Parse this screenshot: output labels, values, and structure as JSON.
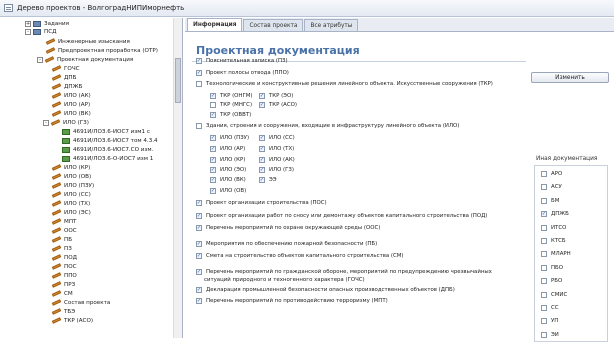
{
  "window": {
    "title": "Дерево проектов - ВолгоградНИПИморнефть"
  },
  "tree": {
    "items": [
      {
        "label": "Задания",
        "icon": "folder-icon",
        "expander": "+"
      },
      {
        "label": "ПСД",
        "icon": "folder-icon",
        "expander": "-"
      },
      {
        "label": "Инженерные изыскания",
        "icon": "pencil-icon"
      },
      {
        "label": "Предпроектная проработка (ОТР)",
        "icon": "pencil-icon"
      },
      {
        "label": "Проектная документация",
        "icon": "pencil-icon",
        "expander": "-"
      },
      {
        "label": "ГОЧС",
        "icon": "pencil-icon"
      },
      {
        "label": "ДПБ",
        "icon": "pencil-icon"
      },
      {
        "label": "ДПЖБ",
        "icon": "pencil-icon"
      },
      {
        "label": "ИЛО (АК)",
        "icon": "pencil-icon"
      },
      {
        "label": "ИЛО (АР)",
        "icon": "pencil-icon"
      },
      {
        "label": "ИЛО (ВК)",
        "icon": "pencil-icon"
      },
      {
        "label": "ИЛО (ГЗ)",
        "icon": "pencil-icon",
        "expander": "-"
      },
      {
        "label": "4691И/ЛОЗ.6-ИОС7 изм1 с",
        "icon": "document-icon"
      },
      {
        "label": "4691И/ЛОЗ.6-ИОС7 том 4.3.4",
        "icon": "document-icon"
      },
      {
        "label": "4691И/ЛОЗ.6-ИОС7.СО изм.",
        "icon": "document-icon"
      },
      {
        "label": "4691И/ЛОЗ.6-О-ИОС7 изм 1",
        "icon": "document-icon"
      },
      {
        "label": "ИЛО (КР)",
        "icon": "pencil-icon"
      },
      {
        "label": "ИЛО (ОВ)",
        "icon": "pencil-icon"
      },
      {
        "label": "ИЛО (ПЗУ)",
        "icon": "pencil-icon"
      },
      {
        "label": "ИЛО (СС)",
        "icon": "pencil-icon"
      },
      {
        "label": "ИЛО (ТХ)",
        "icon": "pencil-icon"
      },
      {
        "label": "ИЛО (ЭС)",
        "icon": "pencil-icon"
      },
      {
        "label": "МПТ",
        "icon": "pencil-icon"
      },
      {
        "label": "ООС",
        "icon": "pencil-icon"
      },
      {
        "label": "ПБ",
        "icon": "pencil-icon"
      },
      {
        "label": "ПЗ",
        "icon": "pencil-icon"
      },
      {
        "label": "ПОД",
        "icon": "pencil-icon"
      },
      {
        "label": "ПОС",
        "icon": "pencil-icon"
      },
      {
        "label": "ППО",
        "icon": "pencil-icon"
      },
      {
        "label": "ПРЗ",
        "icon": "pencil-icon"
      },
      {
        "label": "СМ",
        "icon": "pencil-icon"
      },
      {
        "label": "Состав проекта",
        "icon": "pencil-icon"
      },
      {
        "label": "ТБЭ",
        "icon": "pencil-icon"
      },
      {
        "label": "ТКР (АСО)",
        "icon": "pencil-icon"
      }
    ]
  },
  "tabs": [
    {
      "label": "Информация",
      "active": true
    },
    {
      "label": "Состав проекта",
      "active": false
    },
    {
      "label": "Все атрибуты",
      "active": false
    }
  ],
  "main": {
    "title": "Проектная документация",
    "edit_button": "Изменить",
    "checkboxes": [
      {
        "label": "Пояснительная записка (ПЗ)",
        "checked": true
      },
      {
        "label": "Проект полосы отвода (ППО)",
        "checked": true
      },
      {
        "label": "Технологические и конструктивные решения линейного объекта. Искусственные сооружения (ТКР)",
        "checked": false
      },
      {
        "label": "ТКР (ОНГМ)",
        "checked": true
      },
      {
        "label": "ТКР (ЭО)",
        "checked": true
      },
      {
        "label": "ТКР (МНГС)",
        "checked": false
      },
      {
        "label": "ТКР (АСО)",
        "checked": true
      },
      {
        "label": "ТКР (ОВВТ)",
        "checked": true
      },
      {
        "label": "Здания, строения и сооружения, входящие в инфраструктуру линейного объекта (ИЛО)",
        "checked": false
      },
      {
        "label": "ИЛО (ПЗУ)",
        "checked": true
      },
      {
        "label": "ИЛО (СС)",
        "checked": true
      },
      {
        "label": "ИЛО (АР)",
        "checked": true
      },
      {
        "label": "ИЛО (ТХ)",
        "checked": true
      },
      {
        "label": "ИЛО (КР)",
        "checked": true
      },
      {
        "label": "ИЛО (АК)",
        "checked": true
      },
      {
        "label": "ИЛО (ЭО)",
        "checked": true
      },
      {
        "label": "ИЛО (ГЗ)",
        "checked": true
      },
      {
        "label": "ИЛО (ВК)",
        "checked": true
      },
      {
        "label": "ЭЭ",
        "checked": true
      },
      {
        "label": "ИЛО (ОВ)",
        "checked": true
      },
      {
        "label": "Проект организации строительства (ПОС)",
        "checked": true
      },
      {
        "label": "Проект организации работ по сносу или демонтажу объектов капитального строительства (ПОД)",
        "checked": true
      },
      {
        "label": "Перечень мероприятий по охране окружающей среды (ООС)",
        "checked": true
      },
      {
        "label": "Мероприятия по обеспечению пожарной безопасности (ПБ)",
        "checked": true
      },
      {
        "label": "Смета на строительство объектов капитального строительства (СМ)",
        "checked": true
      },
      {
        "label": "Перечень мероприятий по гражданской обороне, мероприятий по предупреждению чрезвычайных",
        "checked": true
      },
      {
        "label": "ситуаций природного и техногенного характера (ГОЧС)",
        "checked": null
      },
      {
        "label": "Декларация промышленной безопасности опасных производственных объектов (ДПБ)",
        "checked": true
      },
      {
        "label": "Перечень мероприятий по противодействию терроризму (МПТ)",
        "checked": true
      }
    ]
  },
  "other_docs": {
    "title": "Иная документация",
    "items": [
      {
        "label": "АРО",
        "checked": false
      },
      {
        "label": "АСУ",
        "checked": false
      },
      {
        "label": "БМ",
        "checked": false
      },
      {
        "label": "ДПЖБ",
        "checked": true
      },
      {
        "label": "ИТСО",
        "checked": false
      },
      {
        "label": "КТСБ",
        "checked": false
      },
      {
        "label": "МЛАРН",
        "checked": false
      },
      {
        "label": "ПБО",
        "checked": false
      },
      {
        "label": "РБО",
        "checked": false
      },
      {
        "label": "СМИС",
        "checked": false
      },
      {
        "label": "СС",
        "checked": false
      },
      {
        "label": "УП",
        "checked": false
      },
      {
        "label": "ЭИ",
        "checked": false
      }
    ]
  }
}
